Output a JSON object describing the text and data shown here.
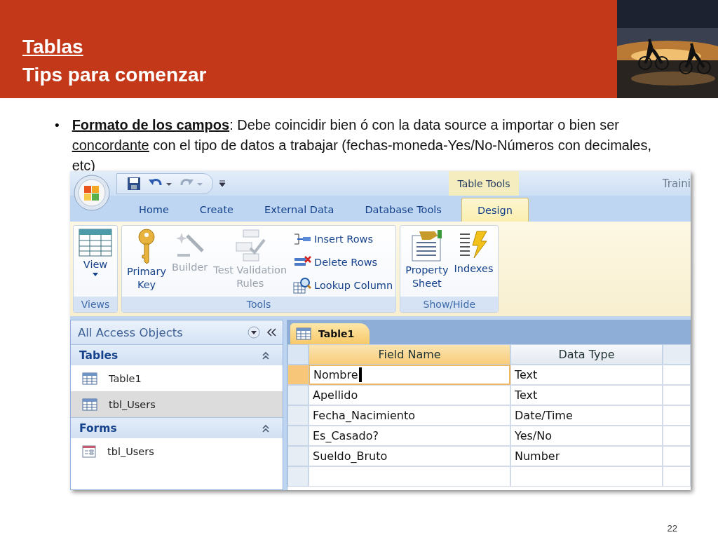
{
  "slide": {
    "title": "Tablas",
    "subtitle": "Tips para comenzar",
    "bullet": {
      "marker": "•",
      "segments": [
        {
          "text": "Formato de los campos",
          "bold": true,
          "underline": true
        },
        {
          "text": ": Debe coincidir bien ó con la data source a importar o bien ser ",
          "bold": false,
          "underline": false
        },
        {
          "text": "concordante",
          "bold": false,
          "underline": true
        },
        {
          "text": " con el tipo de datos a trabajar (fechas-moneda-Yes/No-Números con decimales, etc)",
          "bold": false,
          "underline": false
        }
      ]
    },
    "page_number": "22"
  },
  "access": {
    "window_title": "Traini",
    "contextual_tab": "Table Tools",
    "tabs": [
      {
        "label": "Home",
        "selected": false
      },
      {
        "label": "Create",
        "selected": false
      },
      {
        "label": "External Data",
        "selected": false
      },
      {
        "label": "Database Tools",
        "selected": false
      },
      {
        "label": "Design",
        "selected": true
      }
    ],
    "ribbon_groups": [
      {
        "label": "Views",
        "items": [
          {
            "kind": "large",
            "label": "View",
            "dropdown": true,
            "disabled": false
          }
        ]
      },
      {
        "label": "Tools",
        "items": [
          {
            "kind": "large",
            "label": "Primary\nKey",
            "disabled": false
          },
          {
            "kind": "large",
            "label": "Builder",
            "disabled": true
          },
          {
            "kind": "large",
            "label": "Test Validation\nRules",
            "disabled": true
          },
          {
            "kind": "small",
            "label": "Insert Rows",
            "disabled": false
          },
          {
            "kind": "small",
            "label": "Delete Rows",
            "disabled": false
          },
          {
            "kind": "small",
            "label": "Lookup Column",
            "disabled": false
          }
        ]
      },
      {
        "label": "Show/Hide",
        "items": [
          {
            "kind": "large",
            "label": "Property\nSheet",
            "disabled": false
          },
          {
            "kind": "large",
            "label": "Indexes",
            "disabled": false
          }
        ]
      }
    ],
    "nav_pane": {
      "title": "All Access Objects",
      "sections": [
        {
          "title": "Tables",
          "expanded": true,
          "items": [
            {
              "kind": "table",
              "label": "Table1",
              "selected": false
            },
            {
              "kind": "table",
              "label": "tbl_Users",
              "selected": true
            }
          ]
        },
        {
          "title": "Forms",
          "expanded": true,
          "items": [
            {
              "kind": "form",
              "label": "tbl_Users",
              "selected": false
            }
          ]
        }
      ]
    },
    "document_tab": "Table1",
    "columns": [
      {
        "label": "Field Name",
        "selected": true
      },
      {
        "label": "Data Type",
        "selected": false
      }
    ],
    "rows": [
      {
        "field": "Nombre",
        "type": "Text",
        "selected": true
      },
      {
        "field": "Apellido",
        "type": "Text",
        "selected": false
      },
      {
        "field": "Fecha_Nacimiento",
        "type": "Date/Time",
        "selected": false
      },
      {
        "field": "Es_Casado?",
        "type": "Yes/No",
        "selected": false
      },
      {
        "field": "Sueldo_Bruto",
        "type": "Number",
        "selected": false
      }
    ]
  }
}
